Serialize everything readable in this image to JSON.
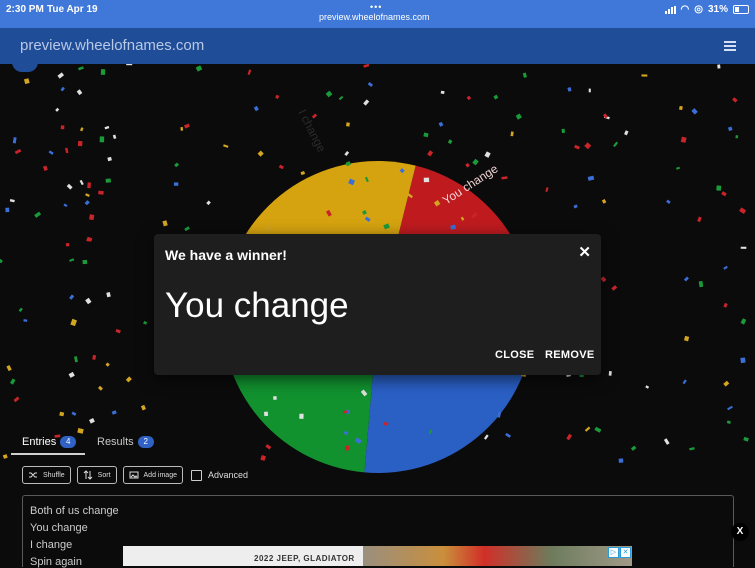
{
  "status_bar": {
    "time": "2:30 PM",
    "date": "Tue Apr 19",
    "url": "preview.wheelofnames.com",
    "battery": "31%"
  },
  "app_bar": {
    "title": "preview.wheelofnames.com",
    "menu_icon": "hamburger-menu-icon"
  },
  "wheel": {
    "segment_labels": [
      "I change",
      "You change"
    ],
    "colors": {
      "yellow": "#d6a310",
      "red": "#bf1b1f",
      "green": "#12912f",
      "blue": "#2a5fc4"
    }
  },
  "dialog": {
    "title": "We have a winner!",
    "winner": "You change",
    "close_label": "CLOSE",
    "remove_label": "REMOVE",
    "close_icon": "close-icon"
  },
  "tabs": [
    {
      "label": "Entries",
      "count": "4"
    },
    {
      "label": "Results",
      "count": "2"
    }
  ],
  "toolbar": {
    "shuffle_label": "Shuffle",
    "sort_label": "Sort",
    "add_image_label": "Add image",
    "advanced_label": "Advanced"
  },
  "entries": [
    "Both of us change",
    "You change",
    "I change",
    "Spin again"
  ],
  "ad": {
    "text": "2022 JEEP, GLADIATOR",
    "close_label": "X"
  },
  "colors": {
    "app_bar": "#1f4d98",
    "status_bar": "#3f78d8",
    "background": "#0b0b0b",
    "dialog_bg": "#1e1e1e",
    "badge": "#2f62c4"
  }
}
